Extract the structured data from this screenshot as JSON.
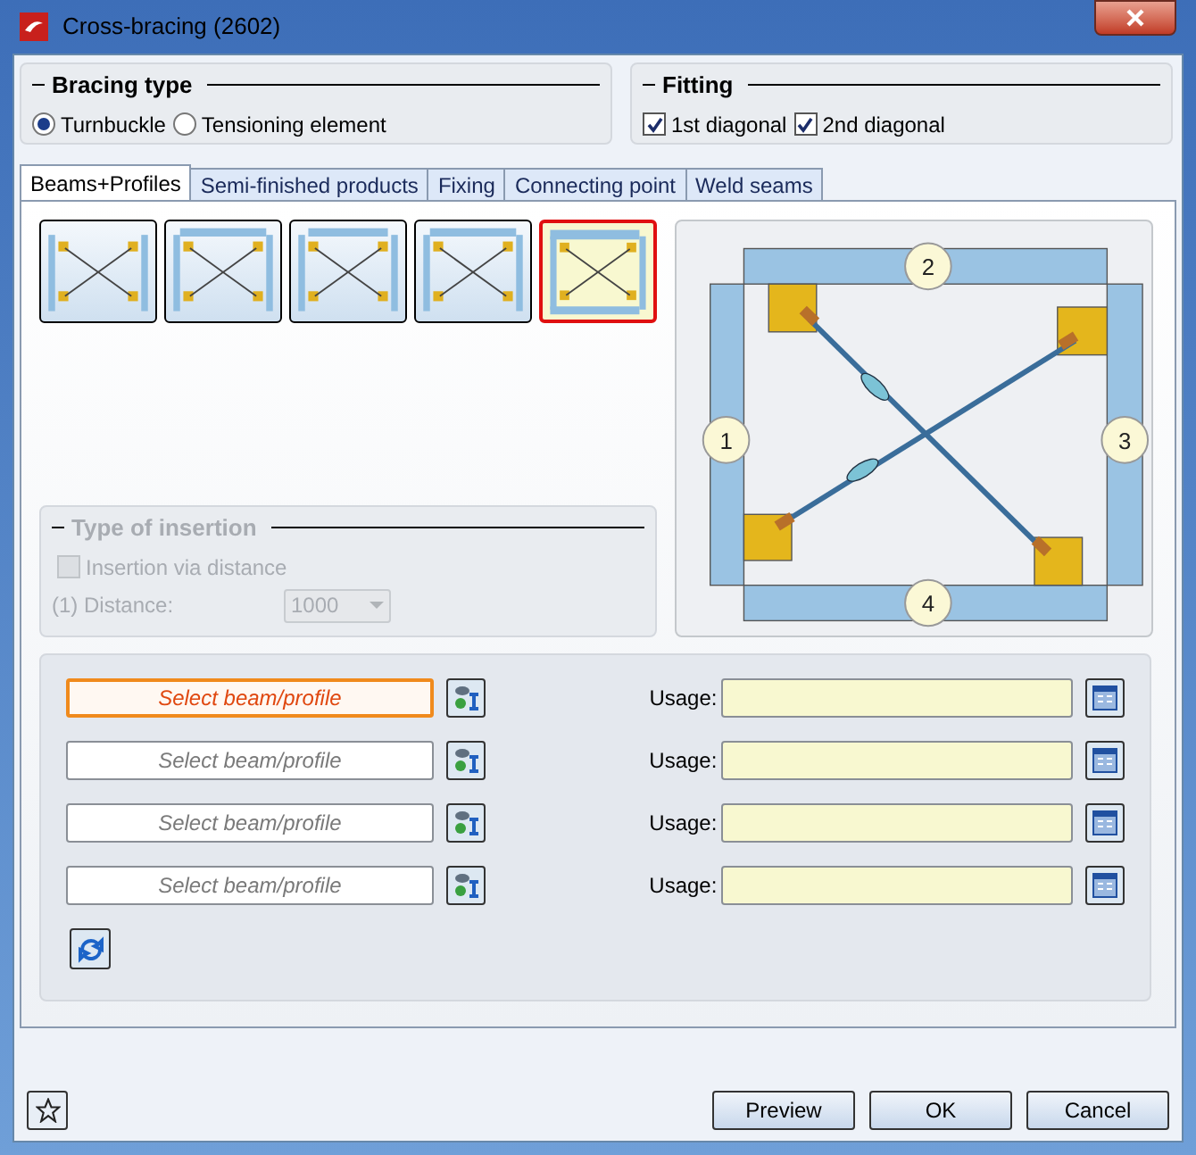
{
  "window": {
    "title": "Cross-bracing (2602)"
  },
  "bracing_type": {
    "label": "Bracing type",
    "options": [
      {
        "label": "Turnbuckle",
        "selected": true
      },
      {
        "label": "Tensioning element",
        "selected": false
      }
    ]
  },
  "fitting": {
    "label": "Fitting",
    "options": [
      {
        "label": "1st diagonal",
        "checked": true
      },
      {
        "label": "2nd diagonal",
        "checked": true
      }
    ]
  },
  "tabs": [
    {
      "label": "Beams+Profiles",
      "selected": true
    },
    {
      "label": "Semi-finished products",
      "selected": false
    },
    {
      "label": "Fixing",
      "selected": false
    },
    {
      "label": "Connecting point",
      "selected": false
    },
    {
      "label": "Weld seams",
      "selected": false
    }
  ],
  "layouts": [
    {
      "kind": "posts",
      "selected": false
    },
    {
      "kind": "top-wide",
      "selected": false
    },
    {
      "kind": "top-inner",
      "selected": false
    },
    {
      "kind": "top-wide",
      "selected": false
    },
    {
      "kind": "frame",
      "selected": true
    }
  ],
  "member_labels": [
    "2",
    "1",
    "3",
    "4"
  ],
  "type_of_insertion": {
    "label": "Type of insertion",
    "disabled": true,
    "checkbox": {
      "label": "Insertion via distance",
      "checked": false
    },
    "distance": {
      "label": "(1) Distance:",
      "value": "1000"
    }
  },
  "profile_rows": [
    {
      "placeholder": "Select beam/profile",
      "active": true,
      "usage_label": "Usage:"
    },
    {
      "placeholder": "Select beam/profile",
      "active": false,
      "usage_label": "Usage:"
    },
    {
      "placeholder": "Select beam/profile",
      "active": false,
      "usage_label": "Usage:"
    },
    {
      "placeholder": "Select beam/profile",
      "active": false,
      "usage_label": "Usage:"
    }
  ],
  "buttons": [
    "Preview",
    "OK",
    "Cancel"
  ]
}
